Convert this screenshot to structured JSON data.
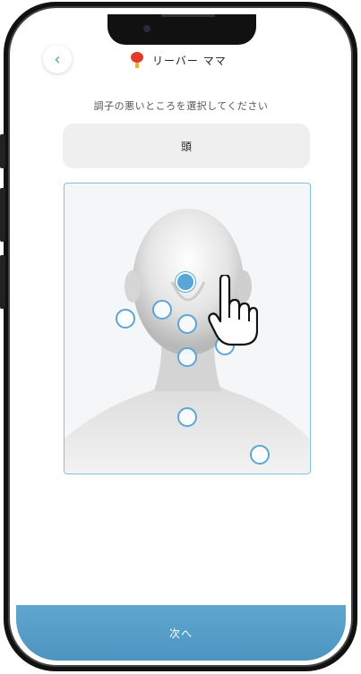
{
  "header": {
    "app_name": "リーバー ママ",
    "back_label": "‹"
  },
  "instruction": "調子の悪いところを選択してください",
  "selected_part": "頭",
  "hotspots": [
    {
      "id": "forehead",
      "active": true
    },
    {
      "id": "left-ear"
    },
    {
      "id": "left-eye"
    },
    {
      "id": "nose"
    },
    {
      "id": "right-cheek"
    },
    {
      "id": "mouth"
    },
    {
      "id": "throat"
    },
    {
      "id": "shoulder"
    }
  ],
  "next_button": "次へ",
  "colors": {
    "accent": "#5aa6d6",
    "button": "#4d95c0",
    "frame_border": "#7fbedd",
    "selection_bg": "#efefef"
  },
  "icons": {
    "back": "chevron-left-icon",
    "logo": "app-logo-icon",
    "pointer": "hand-pointer-icon"
  }
}
